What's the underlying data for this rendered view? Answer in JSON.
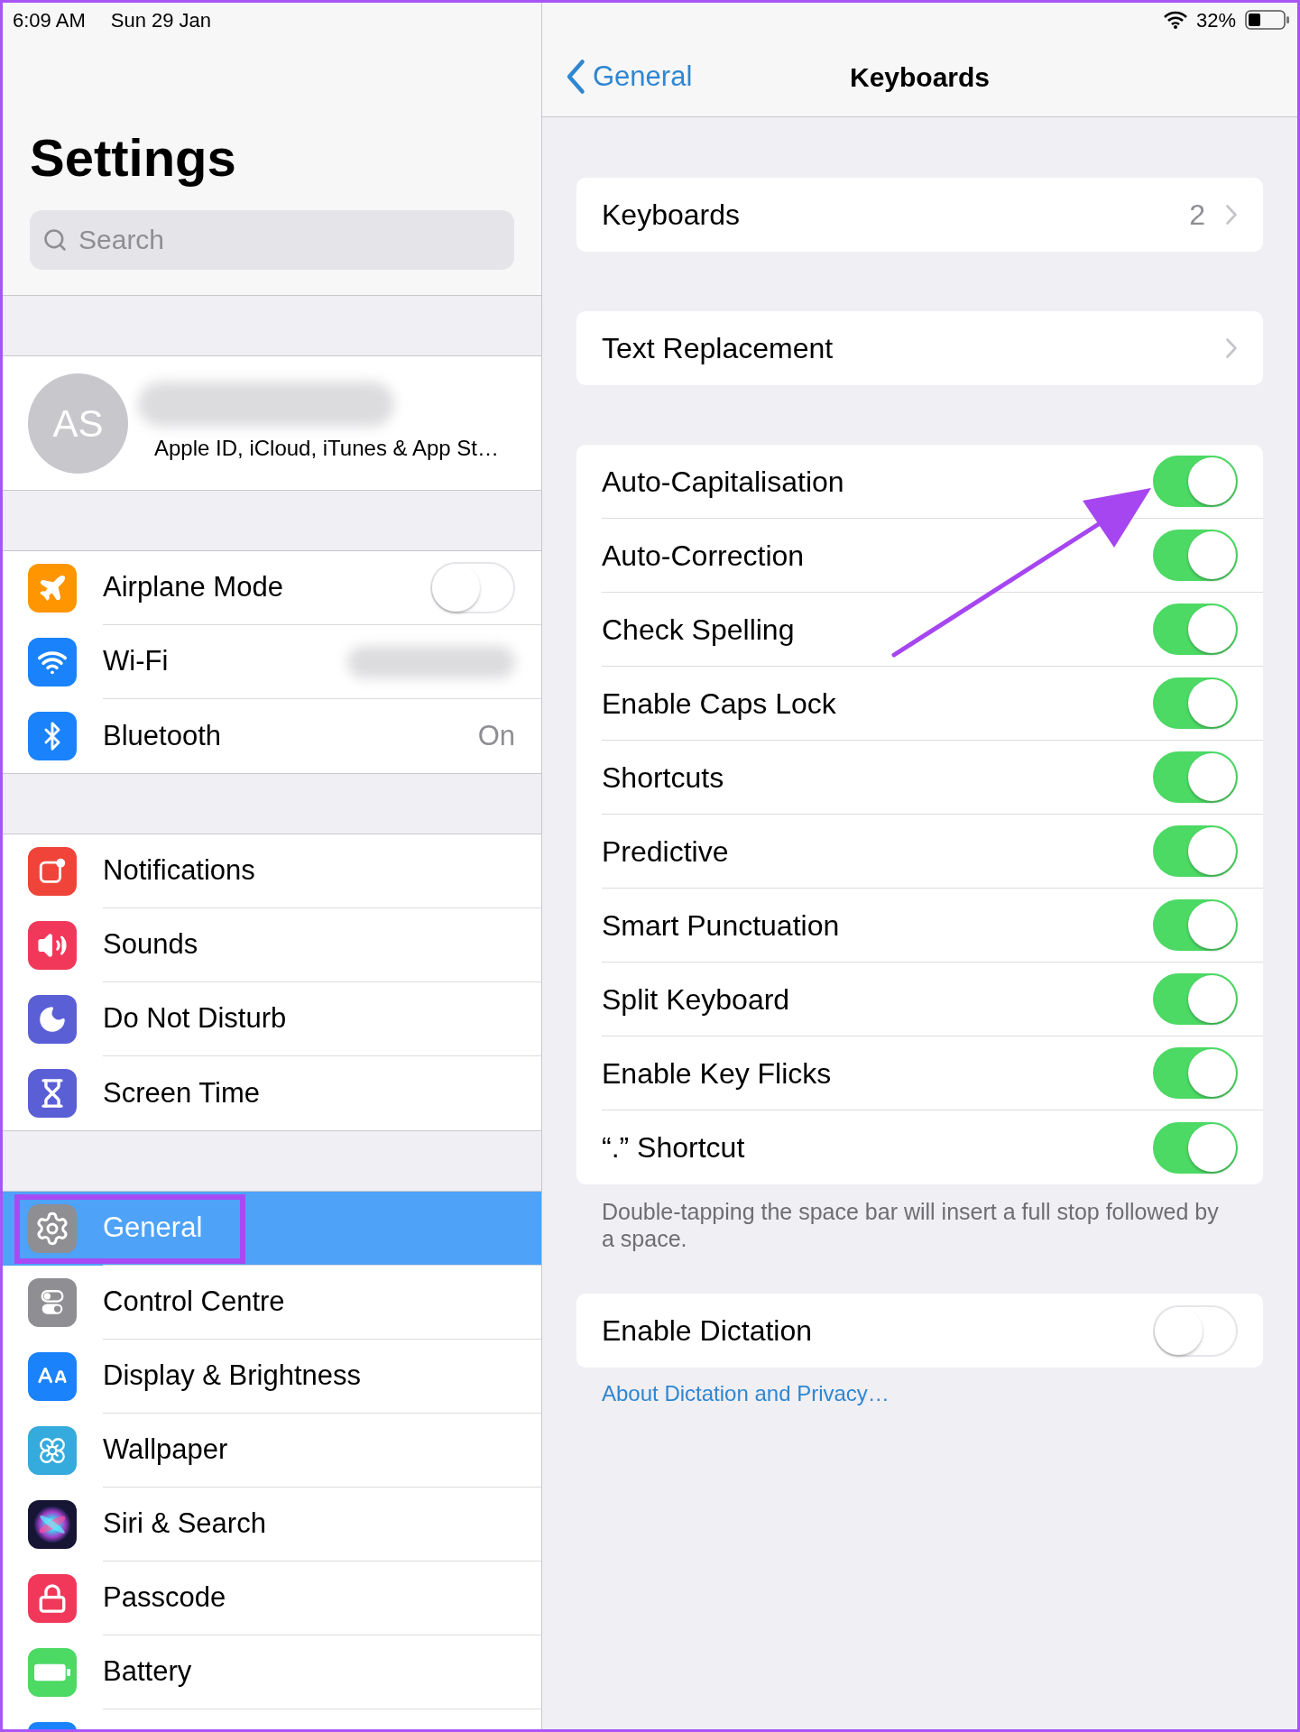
{
  "status_bar": {
    "time": "6:09 AM",
    "date": "Sun 29 Jan",
    "battery": "32%"
  },
  "sidebar": {
    "title": "Settings",
    "search": {
      "placeholder": "Search"
    },
    "account": {
      "initials": "AS",
      "subtitle": "Apple ID, iCloud, iTunes & App St…"
    },
    "groups": [
      {
        "items": [
          {
            "label": "Airplane Mode",
            "kind": "toggle",
            "on": false,
            "selected": false,
            "highlighted": false
          },
          {
            "label": "Wi-Fi",
            "kind": "hidden_value",
            "selected": false,
            "highlighted": false
          },
          {
            "label": "Bluetooth",
            "kind": "value",
            "value": "On",
            "selected": false,
            "highlighted": false
          }
        ]
      },
      {
        "items": [
          {
            "label": "Notifications",
            "kind": "link",
            "selected": false,
            "highlighted": false
          },
          {
            "label": "Sounds",
            "kind": "link",
            "selected": false,
            "highlighted": false
          },
          {
            "label": "Do Not Disturb",
            "kind": "link",
            "selected": false,
            "highlighted": false
          },
          {
            "label": "Screen Time",
            "kind": "link",
            "selected": false,
            "highlighted": false
          }
        ]
      },
      {
        "items": [
          {
            "label": "General",
            "kind": "link",
            "selected": true,
            "highlighted": true
          },
          {
            "label": "Control Centre",
            "kind": "link",
            "selected": false,
            "highlighted": false
          },
          {
            "label": "Display & Brightness",
            "kind": "link",
            "selected": false,
            "highlighted": false
          },
          {
            "label": "Wallpaper",
            "kind": "link",
            "selected": false,
            "highlighted": false
          },
          {
            "label": "Siri & Search",
            "kind": "link",
            "selected": false,
            "highlighted": false
          },
          {
            "label": "Passcode",
            "kind": "link",
            "selected": false,
            "highlighted": false
          },
          {
            "label": "Battery",
            "kind": "link",
            "selected": false,
            "highlighted": false
          },
          {
            "kind": "cut_off",
            "selected": false,
            "highlighted": false
          }
        ]
      }
    ]
  },
  "nav": {
    "back": "General",
    "title": "Keyboards"
  },
  "sections": [
    {
      "rows": [
        {
          "label": "Keyboards",
          "kind": "disclosure",
          "value": "2"
        }
      ]
    },
    {
      "rows": [
        {
          "label": "Text Replacement",
          "kind": "disclosure"
        }
      ]
    },
    {
      "rows": [
        {
          "label": "Auto-Capitalisation",
          "kind": "toggle",
          "on": true,
          "arrow": true
        },
        {
          "label": "Auto-Correction",
          "kind": "toggle",
          "on": true,
          "arrow": false
        },
        {
          "label": "Check Spelling",
          "kind": "toggle",
          "on": true,
          "arrow": false
        },
        {
          "label": "Enable Caps Lock",
          "kind": "toggle",
          "on": true,
          "arrow": false
        },
        {
          "label": "Shortcuts",
          "kind": "toggle",
          "on": true,
          "arrow": false
        },
        {
          "label": "Predictive",
          "kind": "toggle",
          "on": true,
          "arrow": false
        },
        {
          "label": "Smart Punctuation",
          "kind": "toggle",
          "on": true,
          "arrow": false
        },
        {
          "label": "Split Keyboard",
          "kind": "toggle",
          "on": true,
          "arrow": false
        },
        {
          "label": "Enable Key Flicks",
          "kind": "toggle",
          "on": true,
          "arrow": false
        },
        {
          "label": "“.” Shortcut",
          "kind": "toggle",
          "on": true,
          "arrow": false
        }
      ],
      "footer": {
        "kind": "note",
        "text": "Double-tapping the space bar will insert a full stop followed by a space."
      }
    },
    {
      "rows": [
        {
          "label": "Enable Dictation",
          "kind": "toggle",
          "on": false,
          "arrow": false
        }
      ],
      "footer": {
        "kind": "link",
        "text": "About Dictation and Privacy…"
      }
    }
  ]
}
